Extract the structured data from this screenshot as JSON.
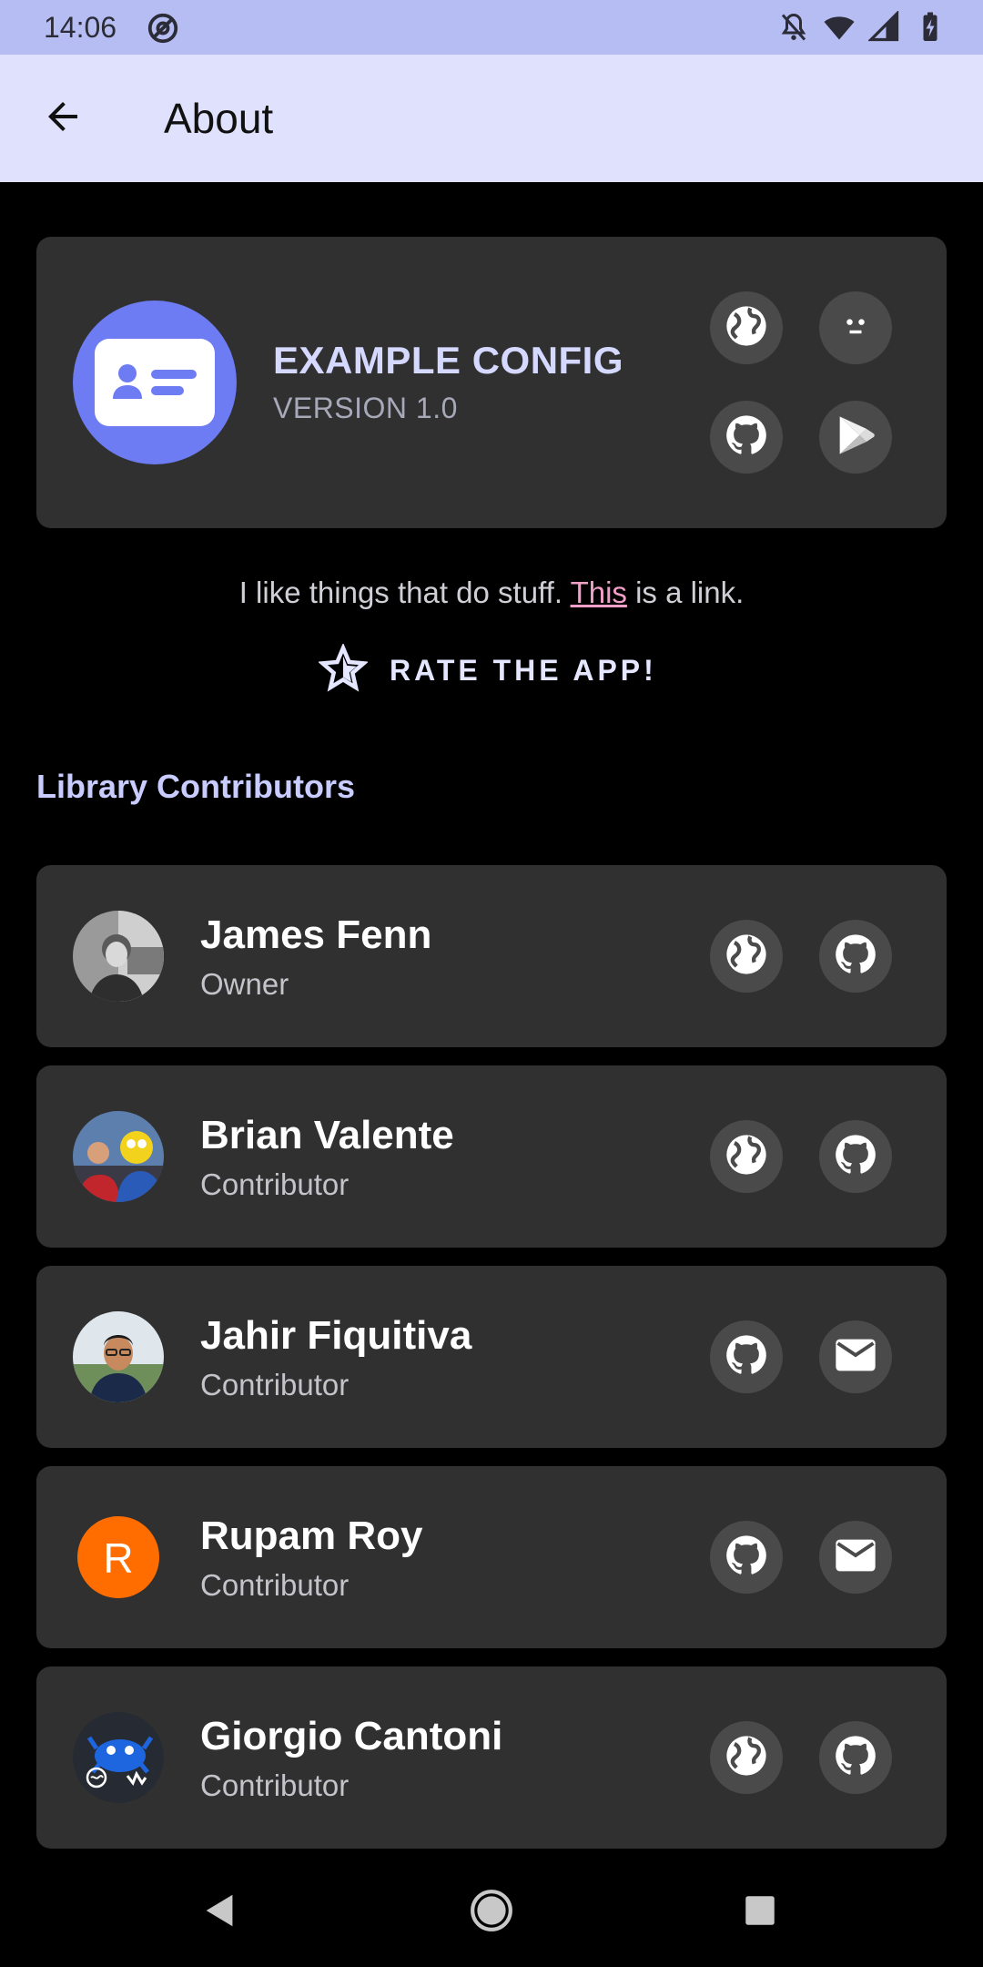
{
  "status_bar": {
    "time": "14:06",
    "left_icons": [
      "at-sign-icon"
    ],
    "right_icons": [
      "notifications-off-icon",
      "wifi-icon",
      "signal-icon",
      "battery-charging-icon"
    ]
  },
  "app_bar": {
    "title": "About",
    "back_icon": "arrow-left-icon"
  },
  "header": {
    "app_name": "EXAMPLE CONFIG",
    "version": "VERSION 1.0",
    "logo_icon": "contact-card-icon",
    "buttons": [
      "globe-icon",
      "face-icon",
      "github-icon",
      "play-store-icon"
    ]
  },
  "description": {
    "before": "I like things that do stuff. ",
    "link_text": "This",
    "after": " is a link."
  },
  "rate": {
    "label": "RATE THE APP!",
    "icon": "star-outline-icon"
  },
  "contributors_section": {
    "title": "Library Contributors",
    "items": [
      {
        "name": "James Fenn",
        "role": "Owner",
        "avatar": "photo-avatar",
        "buttons": [
          "globe-icon",
          "github-icon"
        ]
      },
      {
        "name": "Brian Valente",
        "role": "Contributor",
        "avatar": "photo-avatar",
        "buttons": [
          "globe-icon",
          "github-icon"
        ]
      },
      {
        "name": "Jahir Fiquitiva",
        "role": "Contributor",
        "avatar": "photo-avatar",
        "buttons": [
          "github-icon",
          "email-icon"
        ]
      },
      {
        "name": "Rupam Roy",
        "role": "Contributor",
        "avatar": "letter-avatar",
        "avatar_letter": "R",
        "avatar_color": "#ff6d00",
        "buttons": [
          "github-icon",
          "email-icon"
        ]
      },
      {
        "name": "Giorgio Cantoni",
        "role": "Contributor",
        "avatar": "illustration-avatar",
        "buttons": [
          "globe-icon",
          "github-icon"
        ]
      }
    ]
  },
  "colors": {
    "status_bar": "#b6bdf2",
    "app_bar": "#e0e1fc",
    "card": "#303030",
    "round_button": "#4a4a4a",
    "accent": "#c9ccff",
    "link": "#f0a0c8",
    "logo_circle": "#6d7cf2"
  },
  "nav_bar": {
    "buttons": [
      "back-triangle-icon",
      "home-circle-icon",
      "recents-square-icon"
    ]
  }
}
